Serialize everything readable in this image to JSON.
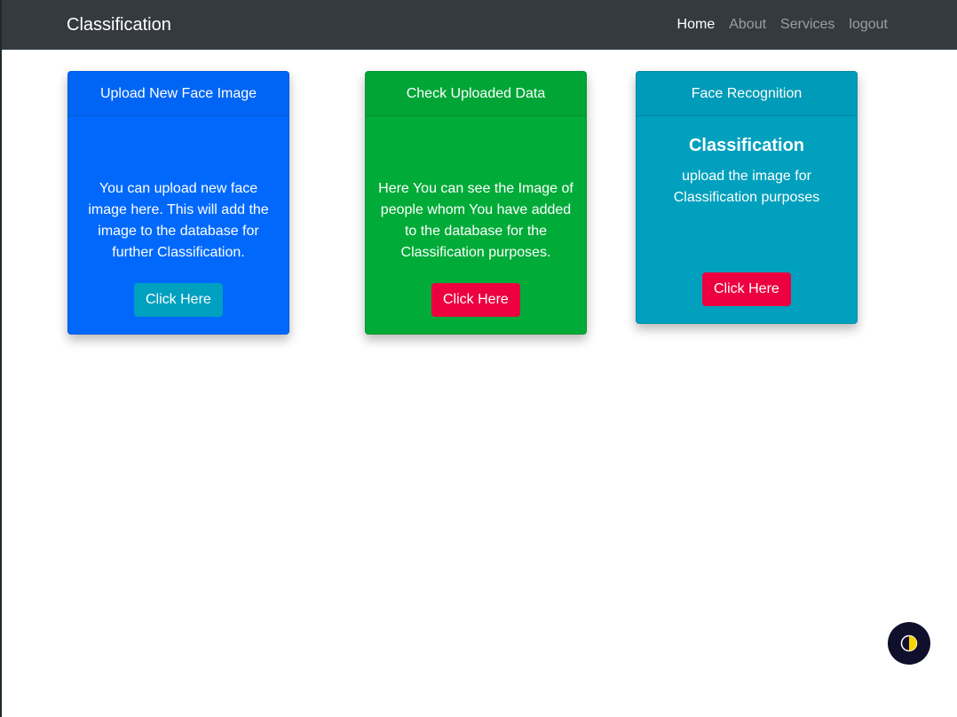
{
  "navbar": {
    "brand": "Classification",
    "links": [
      {
        "label": "Home",
        "active": true
      },
      {
        "label": "About",
        "active": false
      },
      {
        "label": "Services",
        "active": false
      },
      {
        "label": "logout",
        "active": false
      }
    ]
  },
  "cards": [
    {
      "header": "Upload New Face Image",
      "text": "You can upload new face image here. This will add the image to the database for further Classification.",
      "button": "Click Here",
      "color": "#0069fc",
      "button_color": "#00a0c0"
    },
    {
      "header": "Check Uploaded Data",
      "text": "Here You can see the Image of people whom You have added to the database for the Classification purposes.",
      "button": "Click Here",
      "color": "#00ab38",
      "button_color": "#ec003f"
    },
    {
      "header": "Face Recognition",
      "title": "Classification",
      "text": "upload the image for Classification purposes",
      "button": "Click Here",
      "color": "#00a0be",
      "button_color": "#ec003f"
    }
  ],
  "theme_toggle": {
    "icon": "half-moon-icon",
    "colors": {
      "background": "#100f2c",
      "accent": "#f5d400"
    }
  }
}
